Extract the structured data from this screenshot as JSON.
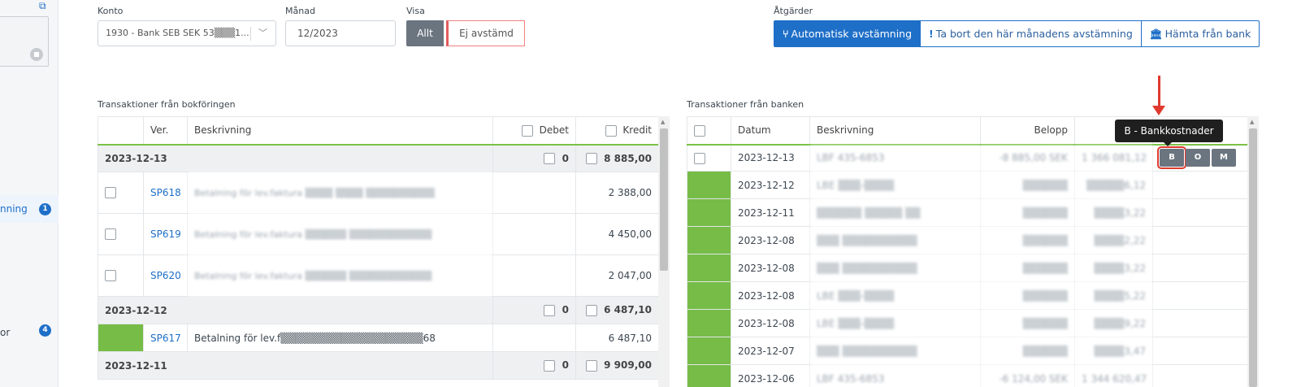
{
  "sidebar": {
    "item_reconcile": {
      "label": "nning",
      "badge": "1"
    },
    "item_other": {
      "label": "or",
      "badge": "4"
    }
  },
  "filters": {
    "konto_label": "Konto",
    "konto_value": "1930 - Bank SEB SEK 53▒▒▒1...",
    "manad_label": "Månad",
    "manad_value": "12/2023",
    "visa_label": "Visa",
    "visa_all": "Allt",
    "visa_unreconciled": "Ej avstämd"
  },
  "actions": {
    "label": "Åtgärder",
    "auto": "Automatisk avstämning",
    "remove": "Ta bort den här månadens avstämning",
    "fetch": "Hämta från bank"
  },
  "ledger": {
    "title": "Transaktioner från bokföringen",
    "headers": {
      "ver": "Ver.",
      "desc": "Beskrivning",
      "debet": "Debet",
      "kredit": "Kredit"
    },
    "groups": [
      {
        "date": "2023-12-13",
        "debet": "0",
        "kredit": "8 885,00"
      },
      {
        "date": "2023-12-12",
        "debet": "0",
        "kredit": "6 487,10"
      },
      {
        "date": "2023-12-11",
        "debet": "0",
        "kredit": "9 909,00"
      }
    ],
    "rows": [
      {
        "ver": "SP618",
        "desc": "Betalning för lev.faktura ▒▒▒▒ ▒▒▒▒ ▒▒▒▒▒▒▒▒▒▒",
        "kredit": "2 388,00"
      },
      {
        "ver": "SP619",
        "desc": "Betalning för lev.faktura ▒▒▒▒▒▒ ▒▒▒▒▒▒▒▒▒▒▒▒",
        "kredit": "4 450,00"
      },
      {
        "ver": "SP620",
        "desc": "Betalning för lev.faktura ▒▒▒▒▒▒ ▒▒▒▒▒▒▒▒▒▒▒▒",
        "kredit": "2 047,00"
      },
      {
        "ver": "SP617",
        "desc": "Betalning för lev.f▒▒▒▒▒▒▒▒▒▒▒▒▒▒▒▒▒▒▒68",
        "kredit": "6 487,10"
      }
    ]
  },
  "bank": {
    "title": "Transaktioner från banken",
    "headers": {
      "datum": "Datum",
      "desc": "Beskrivning",
      "belopp": "Belopp"
    },
    "rows": [
      {
        "datum": "2023-12-13",
        "desc": "LBF 435-6853",
        "belopp": "-8 885,00 SEK",
        "saldo": "1 366 081,12"
      },
      {
        "datum": "2023-12-12",
        "desc": "LBE ▒▒▒-▒▒▒▒",
        "belopp": "▒▒▒▒▒▒",
        "saldo": "▒▒▒▒▒6,12"
      },
      {
        "datum": "2023-12-11",
        "desc": "▒▒▒▒▒▒ ▒▒▒▒▒ ▒▒",
        "belopp": "▒▒▒▒▒▒",
        "saldo": "▒▒▒▒3,22"
      },
      {
        "datum": "2023-12-08",
        "desc": "▒▒▒ ▒▒▒▒▒▒▒▒▒▒",
        "belopp": "▒▒▒▒▒▒",
        "saldo": "▒▒▒▒2,22"
      },
      {
        "datum": "2023-12-08",
        "desc": "▒▒▒ ▒▒▒▒▒▒▒▒▒▒",
        "belopp": "▒▒▒▒▒▒",
        "saldo": "▒▒▒▒3,22"
      },
      {
        "datum": "2023-12-08",
        "desc": "LBE ▒▒▒-▒▒▒▒",
        "belopp": "▒▒▒▒▒▒",
        "saldo": "▒▒▒▒5,22"
      },
      {
        "datum": "2023-12-08",
        "desc": "LBE ▒▒▒-▒▒▒▒",
        "belopp": "▒▒▒▒▒▒",
        "saldo": "▒▒▒▒9,22"
      },
      {
        "datum": "2023-12-07",
        "desc": "▒▒▒ ▒▒▒▒▒▒▒▒▒▒",
        "belopp": "▒▒▒▒▒▒",
        "saldo": "▒▒▒▒3,47"
      },
      {
        "datum": "2023-12-06",
        "desc": "LBF 435-6853",
        "belopp": "-6 124,00 SEK",
        "saldo": "1 344 620,47"
      }
    ],
    "row_buttons": {
      "b": "B",
      "o": "O",
      "m": "M"
    }
  },
  "tooltip": "B - Bankkostnader",
  "colors": {
    "accent": "#1e6fc8",
    "matched": "#76bc47",
    "highlight": "#e03a2e"
  }
}
